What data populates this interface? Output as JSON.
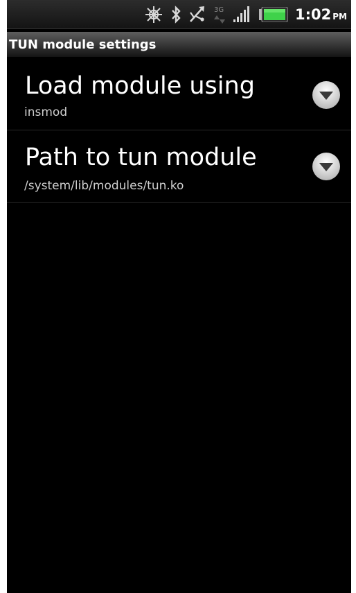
{
  "status_bar": {
    "time": "1:02",
    "ampm": "PM",
    "network_type": "3G",
    "icons": [
      "gps-icon",
      "bluetooth-icon",
      "usb-debugging-icon",
      "3g-data-icon",
      "signal-icon",
      "battery-icon"
    ],
    "battery_color": "#3fd24a"
  },
  "title_bar": {
    "title": "TUN module settings"
  },
  "preferences": [
    {
      "title": "Load module using",
      "summary": "insmod",
      "icon": "dropdown-arrow-icon"
    },
    {
      "title": "Path to tun module",
      "summary": "/system/lib/modules/tun.ko",
      "icon": "dropdown-arrow-icon"
    }
  ]
}
